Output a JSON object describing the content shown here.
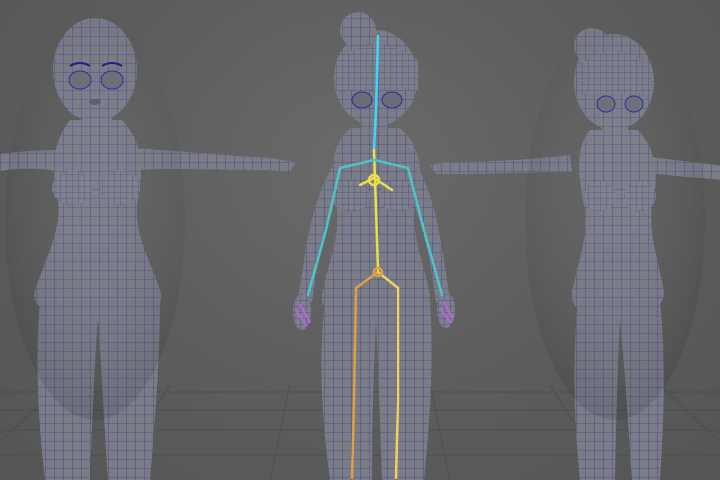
{
  "viewport": {
    "background": "#5d5d5d",
    "grid_color": "#4a4a4a",
    "wire_color": "#2a2a9a",
    "body_fill": "#7a7c86"
  },
  "models": [
    {
      "name": "model-front-view",
      "wire_color": "#2a2a9a"
    },
    {
      "name": "model-rig-view",
      "wire_color": "#2a2a9a",
      "has_skeleton": true
    },
    {
      "name": "model-three-quarter-view",
      "wire_color": "#2a2a9a"
    }
  ],
  "skeleton": {
    "colors": [
      "#3dd6ff",
      "#4bc6c8",
      "#e8e24a",
      "#e0a040",
      "#f0d060",
      "#c060e0"
    ]
  }
}
